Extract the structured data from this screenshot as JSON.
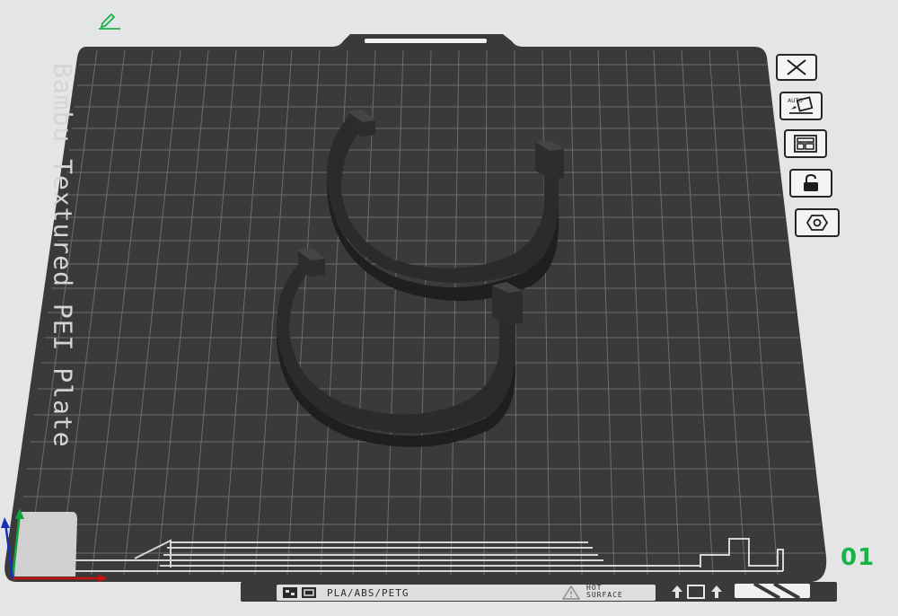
{
  "plate": {
    "title": "Bambu Textured PEI Plate",
    "number": "01",
    "filament_label": "PLA/ABS/PETG",
    "warning_line1": "HOT",
    "warning_line2": "SURFACE"
  },
  "toolbar": {
    "icons": [
      "close-icon",
      "auto-orient-icon",
      "arrange-icon",
      "lock-icon",
      "settings-hex-icon"
    ]
  },
  "colors": {
    "plate": "#3a3a3a",
    "grid": "#6a6a6a",
    "model": "#2b2b2b",
    "accent": "#19b34a"
  }
}
